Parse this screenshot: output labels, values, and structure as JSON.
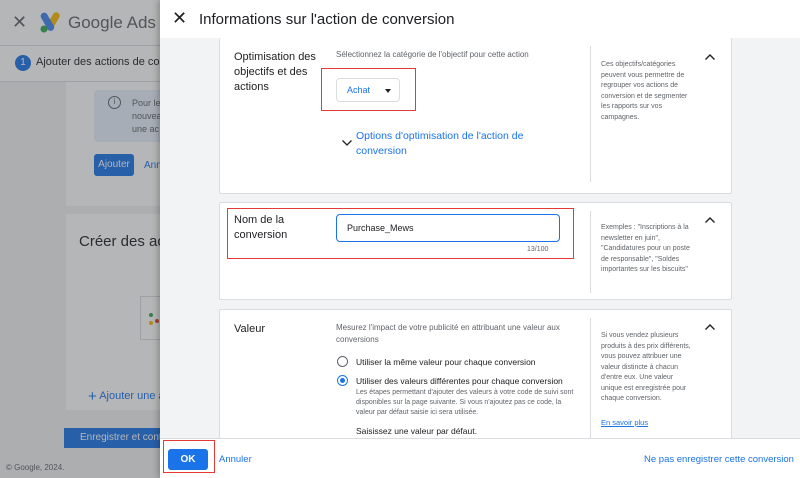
{
  "background": {
    "brand": "Google Ads",
    "step_number": "1",
    "step_label": "Ajouter des actions de conversi",
    "info_text": [
      "Pour le",
      "nouvea",
      "une ac"
    ],
    "add_button": "Ajouter",
    "add_link": "Ann",
    "card_title": "Créer des acti",
    "add_action_link": "Ajouter une ac",
    "save_button": "Enregistrer et conti",
    "footer": "© Google, 2024."
  },
  "dialog": {
    "title": "Informations sur l'action de conversion",
    "goal": {
      "label": "Optimisation des objectifs et des actions",
      "helper": "Sélectionnez la catégorie de l'objectif pour cette action",
      "selected": "Achat",
      "options_link": "Options d'optimisation de l'action de conversion",
      "side_text": "Ces objectifs/catégories peuvent vous permettre de regrouper vos actions de conversion et de segmenter les rapports sur vos campagnes."
    },
    "name": {
      "label": "Nom de la conversion",
      "value": "Purchase_Mews",
      "counter": "13/100",
      "side_text": "Exemples : \"Inscriptions à la newsletter en juin\", \"Candidatures pour un poste de responsable\", \"Soldes importantes sur les biscuits\""
    },
    "value": {
      "label": "Valeur",
      "description": "Mesurez l'impact de votre publicité en attribuant une valeur aux conversions",
      "option_same": "Utiliser la même valeur pour chaque conversion",
      "option_different": "Utiliser des valeurs différentes pour chaque conversion",
      "option_different_sub": "Les étapes permettant d'ajouter des valeurs à votre code de suivi sont disponibles sur la page suivante. Si vous n'ajoutez pas ce code, la valeur par défaut saisie ici sera utilisée.",
      "default_label": "Saisissez une valeur par défaut.",
      "side_text": "Si vous vendez plusieurs produits à des prix différents, vous pouvez attribuer une valeur distincte à chacun d'entre eux. Une valeur unique est enregistrée pour chaque conversion.",
      "side_link": "En savoir plus"
    },
    "footer": {
      "ok": "OK",
      "cancel": "Annuler",
      "no_save": "Ne pas enregistrer cette conversion"
    }
  },
  "colors": {
    "accent": "#1a73e8",
    "highlight": "#e53935"
  }
}
